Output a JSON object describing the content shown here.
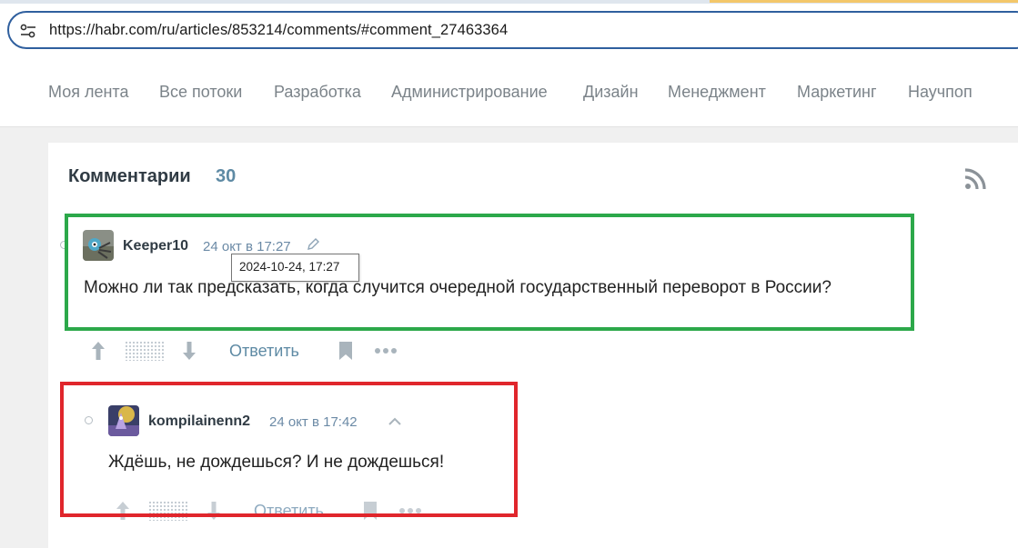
{
  "browser": {
    "url": "https://habr.com/ru/articles/853214/comments/#comment_27463364",
    "site_icon": "site-settings-icon"
  },
  "nav": {
    "items": [
      {
        "label": "Моя лента"
      },
      {
        "label": "Все потоки"
      },
      {
        "label": "Разработка"
      },
      {
        "label": "Администрирование"
      },
      {
        "label": "Дизайн"
      },
      {
        "label": "Менеджмент"
      },
      {
        "label": "Маркетинг"
      },
      {
        "label": "Научпоп"
      }
    ]
  },
  "comments": {
    "title": "Комментарии",
    "count": "30",
    "rss_icon": "rss-icon",
    "items": [
      {
        "author": "Keeper10",
        "date": "24 окт в 17:27",
        "tooltip": "2024-10-24, 17:27",
        "text": "Можно ли так предсказать, когда случится очередной государственный переворот в России?",
        "reply_label": "Ответить"
      },
      {
        "author": "kompilainenn2",
        "date": "24 окт в 17:42",
        "text": "Ждёшь, не дождешься? И не дождешься!",
        "reply_label": "Ответить"
      }
    ]
  },
  "colors": {
    "url_border": "#2f5f9e",
    "accent": "#5e8aa4",
    "highlight_green": "#2ca84a",
    "highlight_red": "#e0262c"
  }
}
